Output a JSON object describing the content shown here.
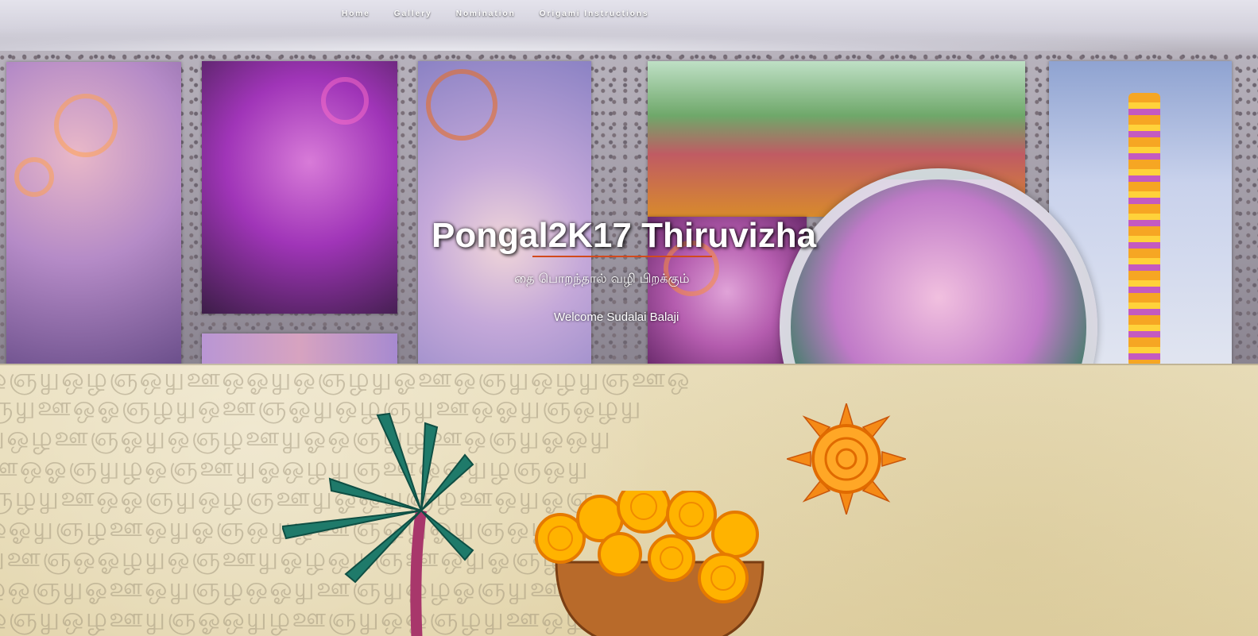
{
  "nav": {
    "items": [
      {
        "label": "Home"
      },
      {
        "label": "Gallery"
      },
      {
        "label": "Nomination"
      },
      {
        "label": "Origami Instructions"
      }
    ]
  },
  "hero": {
    "title": "Pongal2K17 Thiruvizha",
    "subtitle": "தை பொறந்தால் வழி பிறக்கும்",
    "welcome": "Welcome Sudalai Balaji"
  },
  "colors": {
    "accent_underline": "#d24a1c",
    "title_text": "#ffffff",
    "art_background": "#e6d9b2"
  },
  "artwork": {
    "icons": [
      "palm-tree-quilling-icon",
      "pongal-pot-quilling-icon",
      "sun-quilling-icon"
    ]
  }
}
